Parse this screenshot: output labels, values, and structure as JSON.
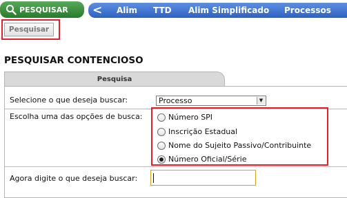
{
  "nav": {
    "search_pill_label": "PESQUISAR",
    "back_label": "<",
    "items": [
      "Alim",
      "TTD",
      "Alim Simplificado",
      "Processos"
    ]
  },
  "toolbar": {
    "pesquisar_button": "Pesquisar"
  },
  "page": {
    "title": "PESQUISAR CONTENCIOSO"
  },
  "tab": {
    "label": "Pesquisa"
  },
  "form": {
    "select_label": "Selecione o que deseja buscar:",
    "select_value": "Processo",
    "options_label": "Escolha uma das opções de busca:",
    "options": [
      {
        "label": "Número SPI",
        "checked": false
      },
      {
        "label": "Inscrição Estadual",
        "checked": false
      },
      {
        "label": "Nome do Sujeito Passivo/Contribuinte",
        "checked": false
      },
      {
        "label": "Número Oficial/Série",
        "checked": true
      }
    ],
    "search_label": "Agora digite o que deseja buscar:",
    "search_value": ""
  },
  "colors": {
    "nav_green": "#2f8a34",
    "nav_blue": "#3d6fd0",
    "highlight_red": "#e0202c",
    "input_border": "#d9a31b"
  },
  "icons": {
    "search_pill_icon": "magnifier-icon",
    "select_arrow": "chevron-down-icon"
  }
}
